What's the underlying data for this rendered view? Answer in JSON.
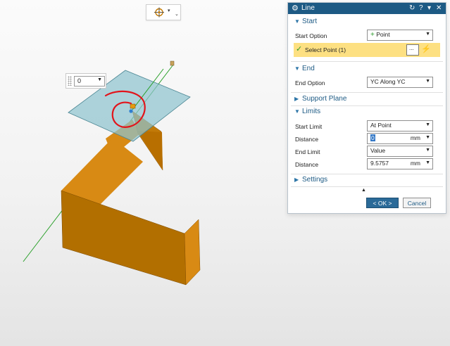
{
  "snap_toolbar": {
    "icon": "crosshair-target-icon",
    "dropdown_glyph": "▾",
    "more_glyph": "⌄"
  },
  "floating_control": {
    "value": "0"
  },
  "dialog": {
    "title": "Line",
    "title_icons": {
      "reset": "↻",
      "help": "?",
      "roll_up": "▾",
      "close": "✕"
    },
    "start": {
      "heading": "Start",
      "option_label": "Start Option",
      "option_value": "Point",
      "select_text": "Select Point (1)",
      "picker_glyph": "..."
    },
    "end": {
      "heading": "End",
      "option_label": "End Option",
      "option_value": "YC Along YC"
    },
    "support_plane": {
      "heading": "Support Plane"
    },
    "limits": {
      "heading": "Limits",
      "start_limit_label": "Start Limit",
      "start_limit_value": "At Point",
      "distance1_label": "Distance",
      "distance1_value": "0",
      "distance1_unit": "mm",
      "end_limit_label": "End Limit",
      "end_limit_value": "Value",
      "distance2_label": "Distance",
      "distance2_value": "9.5757",
      "distance2_unit": "mm"
    },
    "settings": {
      "heading": "Settings"
    },
    "buttons": {
      "ok": "< OK >",
      "cancel": "Cancel"
    }
  },
  "colors": {
    "part_face_front": "#b26f00",
    "part_face_top": "#d88a14",
    "part_face_side": "#c27a08",
    "plane_fill": "#8fc3cf",
    "axis_green": "#2aa02a",
    "annotation_red": "#e2141b",
    "title_bar": "#1d5a84",
    "selection_yellow": "#fde082"
  }
}
